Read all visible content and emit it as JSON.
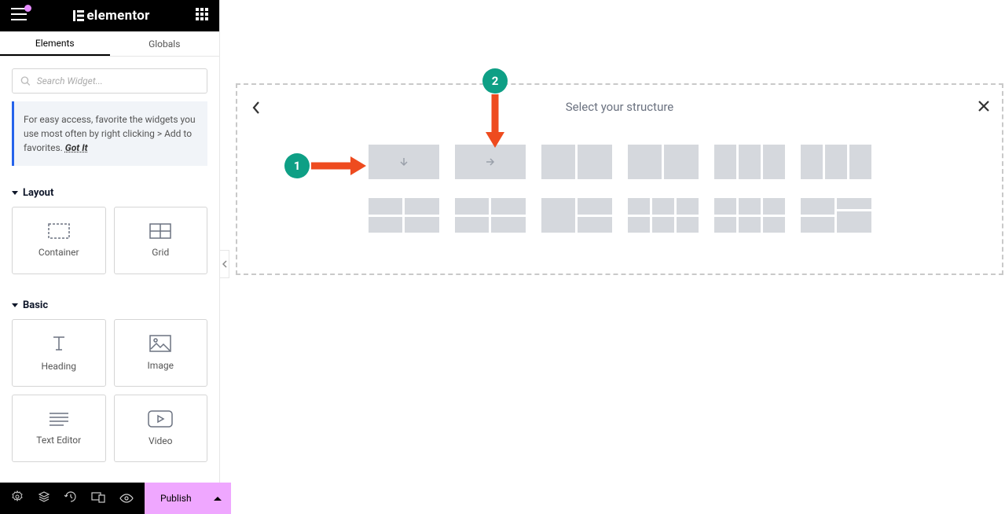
{
  "header": {
    "logo": "elementor"
  },
  "tabs": {
    "elements": "Elements",
    "globals": "Globals"
  },
  "search": {
    "placeholder": "Search Widget..."
  },
  "tip": {
    "text": "For easy access, favorite the widgets you use most often by right clicking > Add to favorites. ",
    "got_it": "Got It"
  },
  "sections": {
    "layout": {
      "title": "Layout",
      "widgets": {
        "container": "Container",
        "grid": "Grid"
      }
    },
    "basic": {
      "title": "Basic",
      "widgets": {
        "heading": "Heading",
        "image": "Image",
        "text_editor": "Text Editor",
        "video": "Video"
      }
    }
  },
  "bottombar": {
    "publish": "Publish"
  },
  "canvas": {
    "title": "Select your structure"
  },
  "annotations": {
    "badge1": "1",
    "badge2": "2"
  }
}
